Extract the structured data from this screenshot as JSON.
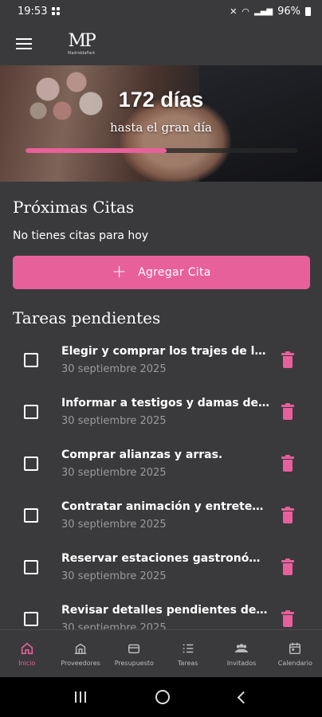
{
  "status_bar": {
    "time": "19:53",
    "battery": "96%"
  },
  "app": {
    "logo_text": "MP",
    "logo_subtitle": "MadriddaPark"
  },
  "hero": {
    "days": "172 días",
    "until": "hasta el gran día",
    "progress_fraction": 0.52
  },
  "appointments": {
    "title": "Próximas Citas",
    "empty_message": "No tienes citas para hoy",
    "add_button": "Agregar Cita"
  },
  "tasks": {
    "title": "Tareas pendientes",
    "items": [
      {
        "title": "Elegir y comprar los trajes de los novios",
        "date": "30 septiembre 2025"
      },
      {
        "title": "Informar a testigos y damas de honor",
        "date": "30 septiembre 2025"
      },
      {
        "title": "Comprar alianzas y arras.",
        "date": "30 septiembre 2025"
      },
      {
        "title": "Contratar animación y entretenimiento",
        "date": "30 septiembre 2025"
      },
      {
        "title": "Reservar estaciones gastronómicas",
        "date": "30 septiembre 2025"
      },
      {
        "title": "Revisar detalles pendientes de la boda",
        "date": "30 septiembre 2025"
      }
    ]
  },
  "bottom_nav": [
    {
      "label": "Inicio",
      "icon": "home-icon"
    },
    {
      "label": "Proveedores",
      "icon": "store-icon"
    },
    {
      "label": "Presupuesto",
      "icon": "wallet-icon"
    },
    {
      "label": "Tareas",
      "icon": "list-icon"
    },
    {
      "label": "Invitados",
      "icon": "people-icon"
    },
    {
      "label": "Calendario",
      "icon": "calendar-icon"
    }
  ],
  "colors": {
    "accent": "#e8609a",
    "surface": "#3a3a3c"
  }
}
